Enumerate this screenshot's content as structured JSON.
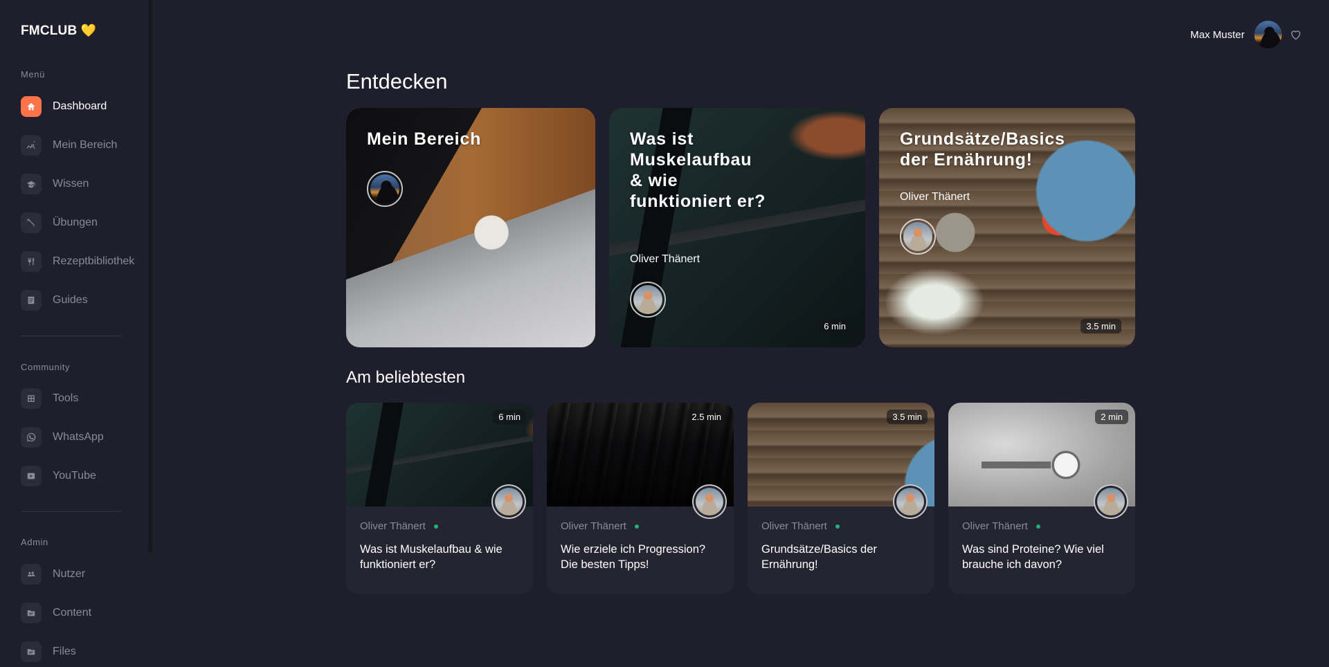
{
  "brand": {
    "name": "FMCLUB",
    "emoji": "💛"
  },
  "sidebar": {
    "sections": [
      {
        "label": "Menü",
        "items": [
          {
            "label": "Dashboard",
            "icon": "home-icon",
            "active": true
          },
          {
            "label": "Mein Bereich",
            "icon": "chart-search-icon",
            "active": false
          },
          {
            "label": "Wissen",
            "icon": "graduation-cap-icon",
            "active": false
          },
          {
            "label": "Übungen",
            "icon": "dumbbell-icon",
            "active": false
          },
          {
            "label": "Rezeptbibliothek",
            "icon": "fork-knife-icon",
            "active": false
          },
          {
            "label": "Guides",
            "icon": "document-icon",
            "active": false
          }
        ]
      },
      {
        "label": "Community",
        "items": [
          {
            "label": "Tools",
            "icon": "calculator-icon",
            "active": false
          },
          {
            "label": "WhatsApp",
            "icon": "whatsapp-icon",
            "active": false
          },
          {
            "label": "YouTube",
            "icon": "youtube-icon",
            "active": false
          }
        ]
      },
      {
        "label": "Admin",
        "items": [
          {
            "label": "Nutzer",
            "icon": "users-icon",
            "active": false
          },
          {
            "label": "Content",
            "icon": "folder-icon",
            "active": false
          },
          {
            "label": "Files",
            "icon": "folder-icon",
            "active": false
          }
        ]
      }
    ]
  },
  "header": {
    "username": "Max Muster",
    "favorites_icon": "heart-icon"
  },
  "main": {
    "discover": {
      "heading": "Entdecken",
      "cards": [
        {
          "title": "Mein Bereich",
          "author": null,
          "duration": null
        },
        {
          "title": "Was ist Muskelaufbau & wie funktioniert er?",
          "author": "Oliver Thänert",
          "duration": "6 min"
        },
        {
          "title": "Grundsätze/Basics der Ernährung!",
          "author": "Oliver Thänert",
          "duration": "3.5 min"
        }
      ]
    },
    "popular": {
      "heading": "Am beliebtesten",
      "cards": [
        {
          "title": "Was ist Muskelaufbau & wie funktioniert er?",
          "author": "Oliver Thänert",
          "duration": "6 min",
          "online": true
        },
        {
          "title": "Wie erziele ich Progression? Die besten Tipps!",
          "author": "Oliver Thänert",
          "duration": "2.5 min",
          "online": true
        },
        {
          "title": "Grundsätze/Basics der Ernährung!",
          "author": "Oliver Thänert",
          "duration": "3.5 min",
          "online": true
        },
        {
          "title": "Was sind Proteine? Wie viel brauche ich davon?",
          "author": "Oliver Thänert",
          "duration": "2 min",
          "online": true
        }
      ]
    }
  },
  "colors": {
    "accent": "#fc7249",
    "online": "#1fb17d",
    "background": "#1f1e2c",
    "card": "#252532",
    "muted": "#8a8a99"
  }
}
